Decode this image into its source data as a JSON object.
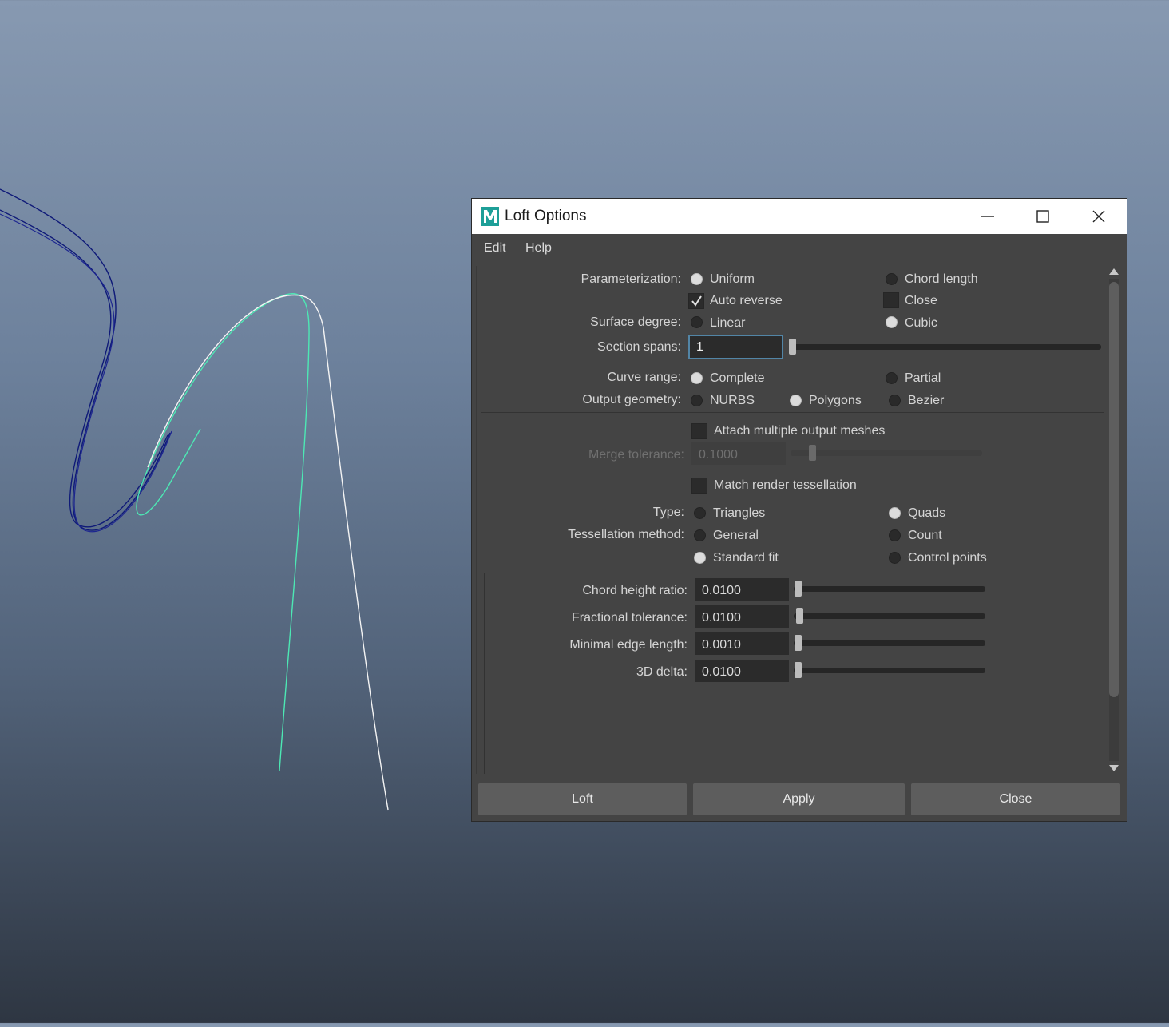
{
  "window": {
    "title": "Loft Options",
    "icon": "maya-icon"
  },
  "menu": [
    "Edit",
    "Help"
  ],
  "parameterization": {
    "label": "Parameterization:",
    "options": [
      "Uniform",
      "Chord length"
    ],
    "selected": "Uniform"
  },
  "auto_reverse": {
    "label": "Auto reverse",
    "checked": true
  },
  "close_option": {
    "label": "Close",
    "checked": false
  },
  "surface_degree": {
    "label": "Surface degree:",
    "options": [
      "Linear",
      "Cubic"
    ],
    "selected": "Cubic"
  },
  "section_spans": {
    "label": "Section spans:",
    "value": "1"
  },
  "curve_range": {
    "label": "Curve range:",
    "options": [
      "Complete",
      "Partial"
    ],
    "selected": "Complete"
  },
  "output_geometry": {
    "label": "Output geometry:",
    "options": [
      "NURBS",
      "Polygons",
      "Bezier"
    ],
    "selected": "Polygons"
  },
  "attach_meshes": {
    "label": "Attach multiple output meshes",
    "checked": false
  },
  "merge_tolerance": {
    "label": "Merge tolerance:",
    "value": "0.1000",
    "enabled": false
  },
  "match_render": {
    "label": "Match render tessellation",
    "checked": false
  },
  "type": {
    "label": "Type:",
    "options": [
      "Triangles",
      "Quads"
    ],
    "selected": "Quads"
  },
  "tessellation_method": {
    "label": "Tessellation method:",
    "options": [
      "General",
      "Count",
      "Standard fit",
      "Control points"
    ],
    "selected": "Standard fit"
  },
  "fields": [
    {
      "label": "Chord height ratio:",
      "value": "0.0100"
    },
    {
      "label": "Fractional tolerance:",
      "value": "0.0100"
    },
    {
      "label": "Minimal edge length:",
      "value": "0.0010"
    },
    {
      "label": "3D delta:",
      "value": "0.0100"
    }
  ],
  "buttons": {
    "loft": "Loft",
    "apply": "Apply",
    "close": "Close"
  },
  "colors": {
    "dialog_bg": "#444444",
    "focus_border": "#5285a6",
    "curve_selected": "#4de8b4",
    "curve_dark": "#101c7a"
  }
}
